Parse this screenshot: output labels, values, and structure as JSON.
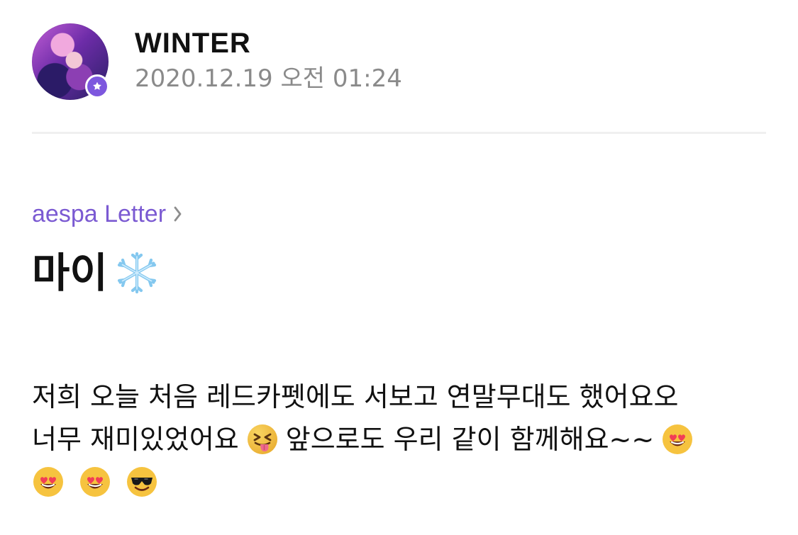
{
  "post": {
    "author_name": "WINTER",
    "timestamp": "2020.12.19 오전 01:24",
    "category": "aespa Letter",
    "title": "마이",
    "body": {
      "line1": "저희 오늘 처음 레드카펫에도 서보고 연말무대도 했어요오",
      "line2a": "너무 재미있었어요",
      "line2b": "앞으로도 우리 같이 함께해요~~"
    }
  },
  "icons": {
    "avatar": "avatar-photo",
    "badge": "star-badge-icon",
    "category_link": "chevron-right-icon",
    "title_icon": "snowflake-icon",
    "emoji_1": "squinting-face-with-tongue-icon",
    "emoji_2": "heart-eyes-icon",
    "emoji_3": "heart-eyes-icon",
    "emoji_4": "heart-eyes-icon",
    "emoji_5": "sunglasses-face-icon"
  },
  "colors": {
    "accent": "#7b5ad2",
    "timestamp": "#8a8a8a",
    "text": "#111111"
  }
}
